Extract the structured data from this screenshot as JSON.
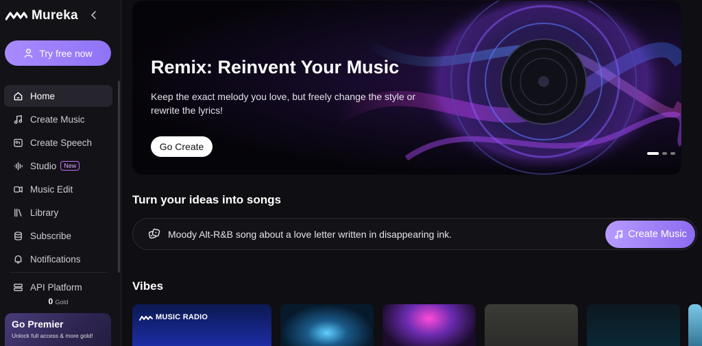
{
  "app": {
    "name": "Mureka"
  },
  "sidebar": {
    "try_label": "Try free now",
    "items": [
      {
        "label": "Home",
        "icon": "home-icon"
      },
      {
        "label": "Create Music",
        "icon": "music-note-icon"
      },
      {
        "label": "Create Speech",
        "icon": "speech-icon"
      },
      {
        "label": "Studio",
        "icon": "waveform-icon",
        "badge": "New"
      },
      {
        "label": "Music Edit",
        "icon": "music-edit-icon"
      },
      {
        "label": "Library",
        "icon": "library-icon"
      },
      {
        "label": "Subscribe",
        "icon": "coins-icon"
      },
      {
        "label": "Notifications",
        "icon": "bell-icon"
      },
      {
        "label": "API Platform",
        "icon": "api-icon"
      }
    ],
    "gold": {
      "value": "0",
      "unit": "Gold"
    },
    "premier": {
      "title": "Go Premier",
      "subtitle": "Unlock full access & more gold!"
    }
  },
  "hero": {
    "title": "Remix: Reinvent Your Music",
    "description": "Keep the exact melody you love, but freely change the style or rewrite the lyrics!",
    "button": "Go Create",
    "slides": 3,
    "active_slide": 1
  },
  "ideas": {
    "title": "Turn your ideas into songs",
    "prompt": "Moody Alt-R&B song about a love letter written in disappearing ink.",
    "create_button": "Create Music"
  },
  "vibes": {
    "title": "Vibes",
    "cards": [
      {
        "label": "MUSIC RADIO"
      },
      {
        "label": ""
      },
      {
        "label": ""
      },
      {
        "label": ""
      },
      {
        "label": ""
      },
      {
        "label": ""
      }
    ]
  },
  "colors": {
    "accent": "#9b7cf7",
    "background": "#0f0e12",
    "sidebar": "#131217",
    "new_badge": "#c46bff"
  }
}
